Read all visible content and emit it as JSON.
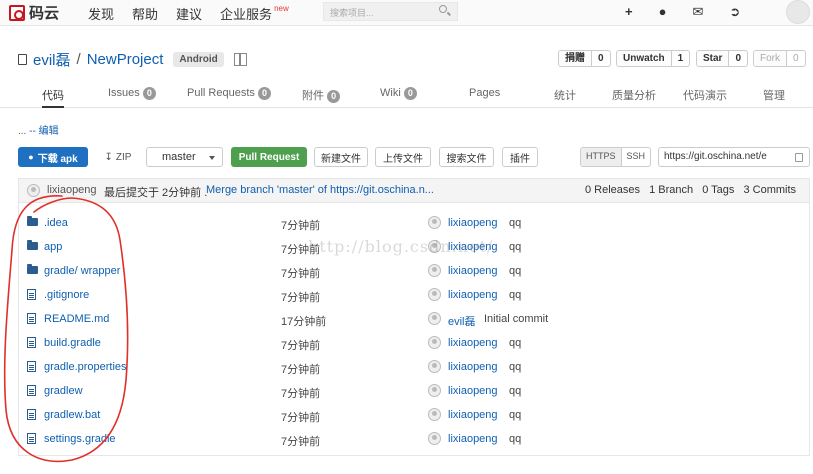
{
  "topbar": {
    "logo_text": "码云",
    "nav": [
      "发现",
      "帮助",
      "建议",
      "企业服务"
    ],
    "nav_new_badge": "new",
    "search_placeholder": "搜索项目...",
    "icons": [
      "plus-icon",
      "user-icon",
      "mail-icon",
      "logout-icon"
    ]
  },
  "project": {
    "owner": "evil磊",
    "separator": "/",
    "name": "NewProject",
    "language": "Android",
    "counters": [
      {
        "label": "捐赠",
        "count": "0"
      },
      {
        "label": "Unwatch",
        "count": "1"
      },
      {
        "label": "Star",
        "count": "0"
      },
      {
        "label": "Fork",
        "count": "0",
        "disabled": true
      }
    ]
  },
  "tabs": [
    {
      "label": "代码",
      "active": true
    },
    {
      "label": "Issues",
      "badge": "0"
    },
    {
      "label": "Pull Requests",
      "badge": "0"
    },
    {
      "label": "附件",
      "badge": "0"
    },
    {
      "label": "Wiki",
      "badge": "0"
    },
    {
      "label": "Pages"
    },
    {
      "label": "统计"
    },
    {
      "label": "质量分析"
    },
    {
      "label": "代码演示"
    },
    {
      "label": "管理"
    }
  ],
  "breadcrumb": {
    "dots": "...",
    "edit": "-- 编辑"
  },
  "toolbar": {
    "download_apk": "下载 apk",
    "zip": "ZIP",
    "branch": "master",
    "pull_request": "Pull Request",
    "new_file": "新建文件",
    "upload_file": "上传文件",
    "search_file": "搜索文件",
    "plugins": "插件",
    "https": "HTTPS",
    "ssh": "SSH",
    "clone_url": "https://git.oschina.net/e"
  },
  "last_commit": {
    "user": "lixiaopeng",
    "text": "最后提交于 2分钟前 .",
    "message": "Merge branch 'master' of https://git.oschina.n...",
    "releases": "0 Releases",
    "branches": "1 Branch",
    "tags": "0 Tags",
    "commits": "3 Commits"
  },
  "files": [
    {
      "name": ".idea",
      "type": "folder",
      "time": "7分钟前",
      "user": "lixiaopeng",
      "msg": "qq"
    },
    {
      "name": "app",
      "type": "folder",
      "time": "7分钟前",
      "user": "lixiaopeng",
      "msg": "qq"
    },
    {
      "name": "gradle/ wrapper",
      "type": "folder",
      "time": "7分钟前",
      "user": "lixiaopeng",
      "msg": "qq"
    },
    {
      "name": ".gitignore",
      "type": "file",
      "time": "7分钟前",
      "user": "lixiaopeng",
      "msg": "qq"
    },
    {
      "name": "README.md",
      "type": "file",
      "time": "17分钟前",
      "user": "evil磊",
      "msg": "Initial commit"
    },
    {
      "name": "build.gradle",
      "type": "file",
      "time": "7分钟前",
      "user": "lixiaopeng",
      "msg": "qq"
    },
    {
      "name": "gradle.properties",
      "type": "file",
      "time": "7分钟前",
      "user": "lixiaopeng",
      "msg": "qq"
    },
    {
      "name": "gradlew",
      "type": "file",
      "time": "7分钟前",
      "user": "lixiaopeng",
      "msg": "qq"
    },
    {
      "name": "gradlew.bat",
      "type": "file",
      "time": "7分钟前",
      "user": "lixiaopeng",
      "msg": "qq"
    },
    {
      "name": "settings.gradle",
      "type": "file",
      "time": "7分钟前",
      "user": "lixiaopeng",
      "msg": "qq"
    }
  ],
  "watermark": "http://blog.csdn.net/",
  "colors": {
    "link": "#0f5fb0",
    "brand": "#c7161e",
    "green": "#4ea04e",
    "blue": "#1f70c0",
    "annotation": "#e0302a"
  }
}
